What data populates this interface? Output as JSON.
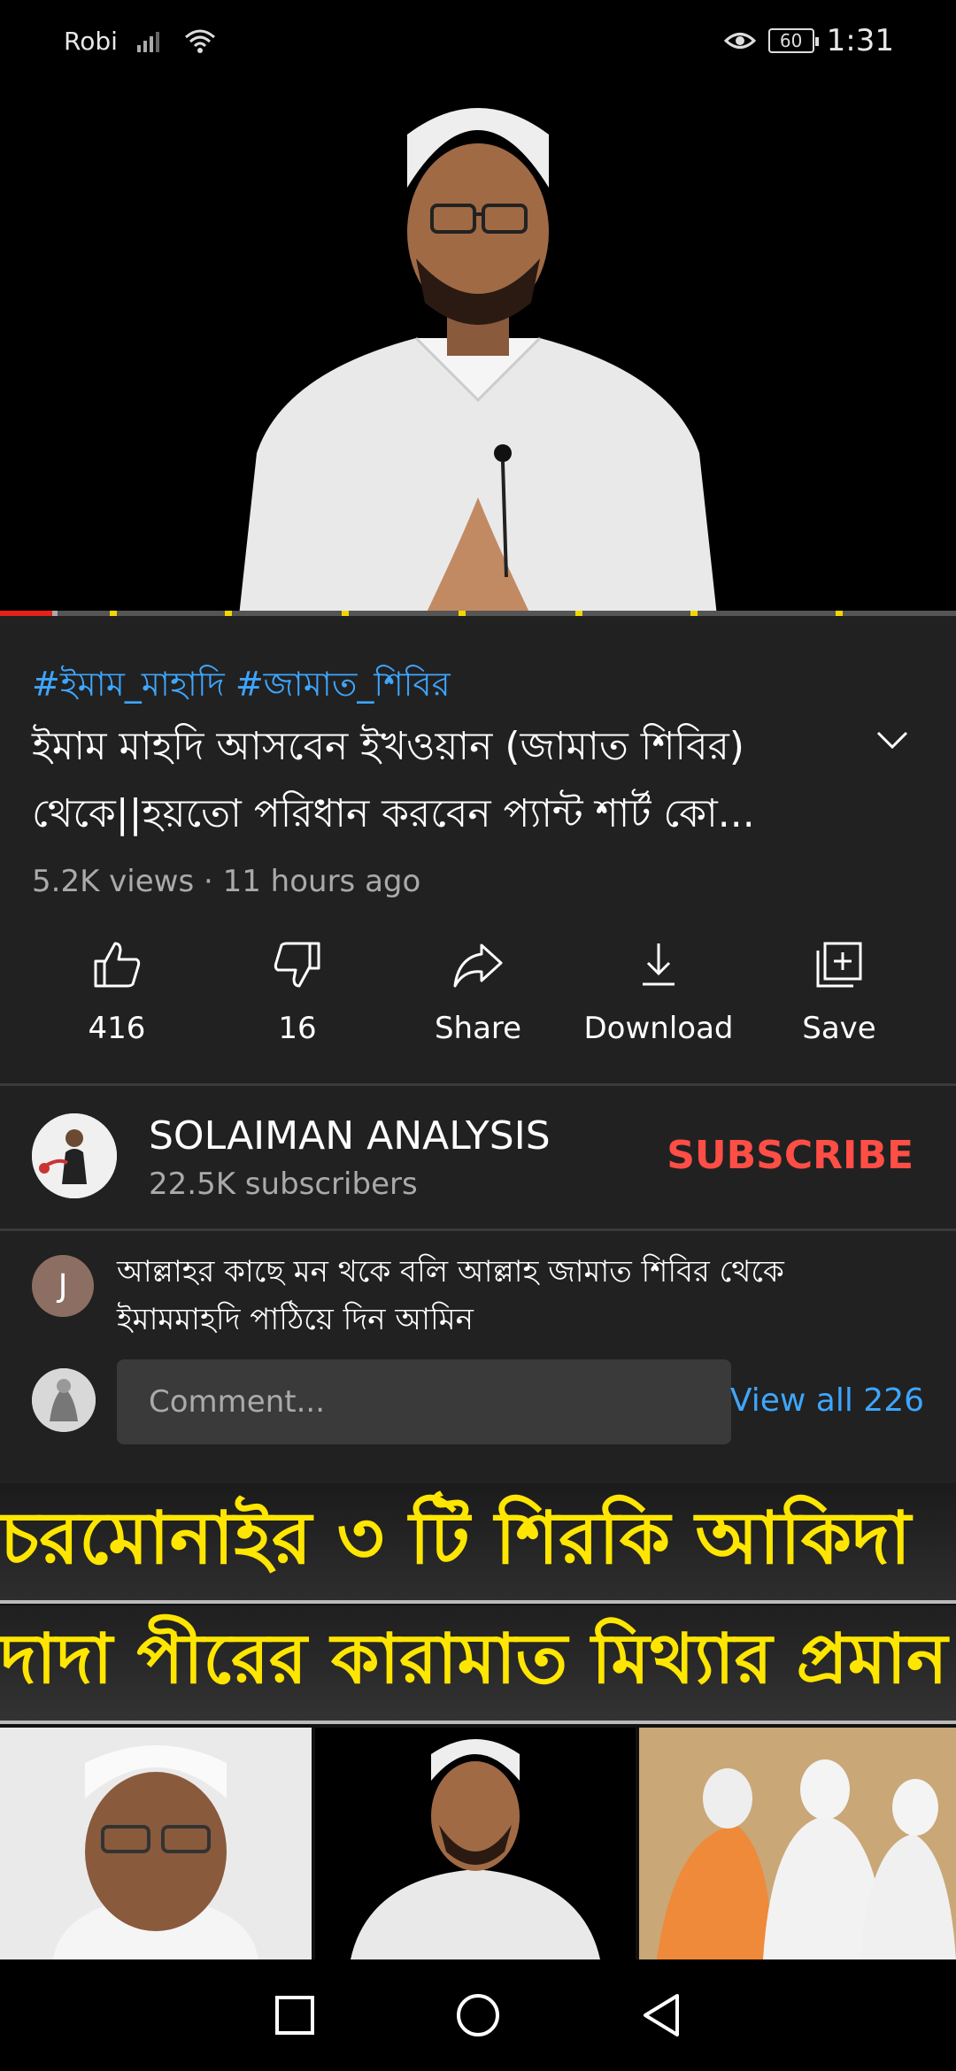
{
  "status_bar": {
    "carrier": "Robi",
    "battery": "60",
    "time": "1:31"
  },
  "video": {
    "progress_fraction": 0.055,
    "buffer_fraction": 0.06
  },
  "info": {
    "hashtags": "#ইমাম_মাহাদি #জামাত_শিবির",
    "title": "ইমাম মাহদি আসবেন ইখওয়ান (জামাত শিবির) থেকে||হয়তো পরিধান করবেন প্যান্ট শার্ট কো...",
    "meta": "5.2K views · 11 hours ago"
  },
  "actions": {
    "like": "416",
    "dislike": "16",
    "share": "Share",
    "download": "Download",
    "save": "Save"
  },
  "channel": {
    "name": "SOLAIMAN ANALYSIS",
    "subscribers": "22.5K subscribers",
    "subscribe_label": "SUBSCRIBE"
  },
  "comments": {
    "top_comment_initial": "J",
    "top_comment": "আল্লাহর কাছে মন থকে বলি আল্লাহ জামাত শিবির থেকে ইমামমাহদি  পাঠিয়ে দিন আমিন",
    "input_placeholder": "Comment...",
    "view_all": "View all 226"
  },
  "next_video": {
    "line1": "চরমোনাইর ৩ টি শিরকি আকিদা",
    "line2": "দাদা পীরের কারামাত মিথ্যার প্রমান"
  },
  "colors": {
    "background": "#212121",
    "link": "#3ea6ff",
    "subscribe": "#ff4e45",
    "progress": "#e62117",
    "thumb_text": "#ffe600"
  },
  "icons": [
    "signal-icon",
    "wifi-icon",
    "eye-icon",
    "battery-icon",
    "chevron-down-icon",
    "like-icon",
    "dislike-icon",
    "share-icon",
    "download-icon",
    "save-icon",
    "square-nav-icon",
    "circle-nav-icon",
    "back-triangle-icon"
  ]
}
